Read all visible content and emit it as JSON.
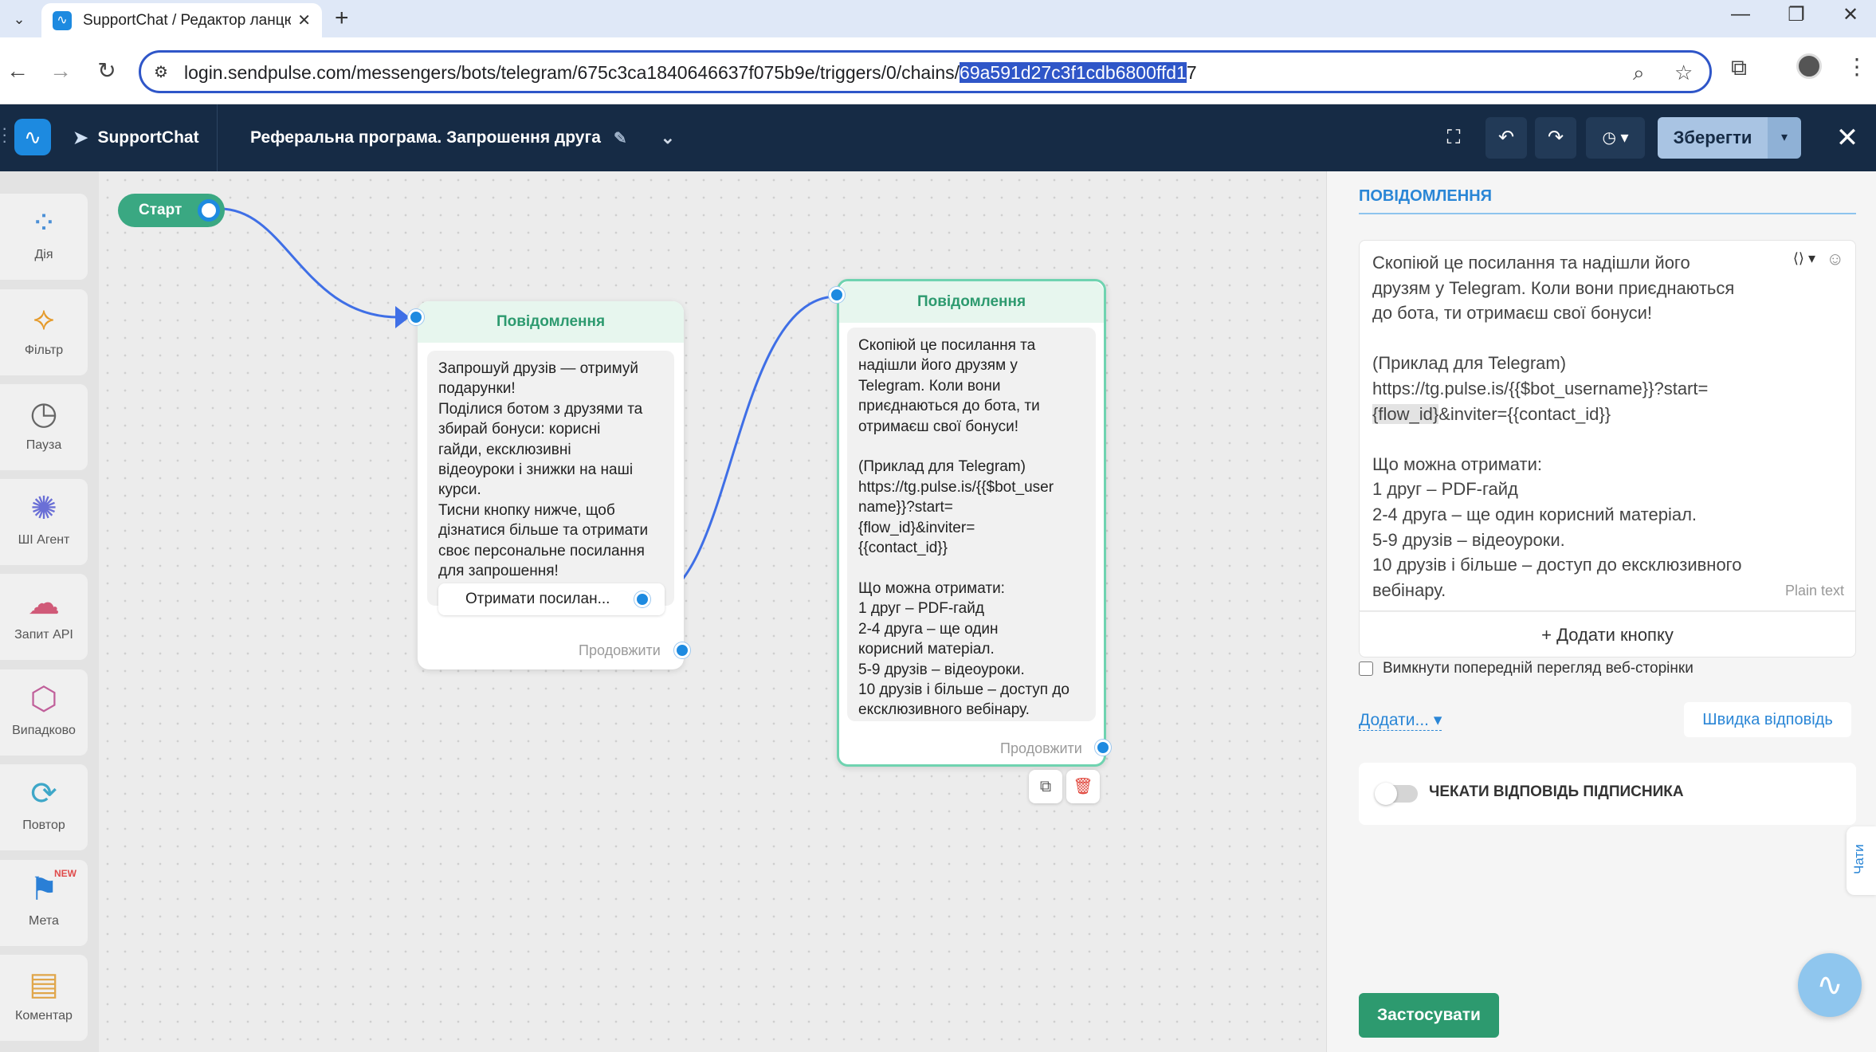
{
  "browser": {
    "tab_title": "SupportChat / Редактор ланцю",
    "url_prefix": "login.sendpulse.com/messengers/bots/telegram/675c3ca1840646637f075b9e/triggers/0/chains/",
    "url_selected": "69a591d27c3f1cdb6800ffd1",
    "url_suffix": "7"
  },
  "header": {
    "bot_name": "SupportChat",
    "flow_name": "Реферальна програма. Запрошення друга",
    "save_label": "Зберегти"
  },
  "sidebar": {
    "items": [
      {
        "label": "Дія",
        "icon": "action-icon"
      },
      {
        "label": "Фільтр",
        "icon": "filter-icon"
      },
      {
        "label": "Пауза",
        "icon": "clock-icon"
      },
      {
        "label": "ШІ Агент",
        "icon": "ai-agent-icon"
      },
      {
        "label": "Запит API",
        "icon": "api-request-icon"
      },
      {
        "label": "Випадково",
        "icon": "random-icon"
      },
      {
        "label": "Повтор",
        "icon": "repeat-icon"
      },
      {
        "label": "Мета",
        "icon": "goal-flag-icon",
        "badge": "NEW"
      },
      {
        "label": "Коментар",
        "icon": "comment-icon"
      }
    ]
  },
  "canvas": {
    "start_label": "Старт",
    "node1": {
      "title": "Повідомлення",
      "text": "Запрошуй друзів — отримуй\nподарунки!\nПоділися ботом з друзями та\nзбирай бонуси: корисні\nгайди, ексклюзивні\nвідеоуроки і знижки на наші\nкурси.\nТисни кнопку нижче, щоб\nдізнатися більше та отримати\nсвоє персональне посилання\nдля запрошення!",
      "button": "Отримати посилан...",
      "continue": "Продовжити"
    },
    "node2": {
      "title": "Повідомлення",
      "text": "Скопіюй це посилання та\nнадішли його друзям у\nTelegram. Коли вони\nприєднаються до бота, ти\nотримаєш свої бонуси!\n\n(Приклад для Telegram)\nhttps://tg.pulse.is/{{$bot_user\nname}}?start=\n{flow_id}&inviter=\n{{contact_id}}\n\nЩо можна отримати:\n1 друг – PDF-гайд\n2-4 друга – ще один\nкорисний матеріал.\n5-9 друзів – відеоуроки.\n10 друзів і більше – доступ до\nексклюзивного вебінару.",
      "continue": "Продовжити"
    }
  },
  "panel": {
    "title": "ПОВІДОМЛЕННЯ",
    "text_before": "Скопіюй це посилання та надішли його\nдрузям у Telegram. Коли вони приєднаються\nдо бота, ти отримаєш свої бонуси!\n\n(Приклад для Telegram)\nhttps://tg.pulse.is/{{$bot_username}}?start=\n",
    "text_highlight": "{flow_id}",
    "text_after": "&inviter={{contact_id}}\n\nЩо можна отримати:\n1 друг – PDF-гайд\n2-4 друга – ще один корисний матеріал.\n5-9 друзів – відеоуроки.\n10 друзів і більше – доступ до ексклюзивного\nвебінару.",
    "format_label": "Plain text",
    "add_button": "+ Додати кнопку",
    "disable_preview": "Вимкнути попередній перегляд веб-сторінки",
    "add_menu": "Додати...",
    "quick_reply": "Швидка відповідь",
    "wait_reply": "ЧЕКАТИ ВІДПОВІДЬ ПІДПИСНИКА",
    "apply": "Застосувати",
    "chats_tab": "Чати"
  },
  "colors": {
    "accent": "#1d8ae0",
    "header_bg": "#162b45",
    "node_green": "#2d9a6f",
    "link_blue": "#2a86d6"
  }
}
